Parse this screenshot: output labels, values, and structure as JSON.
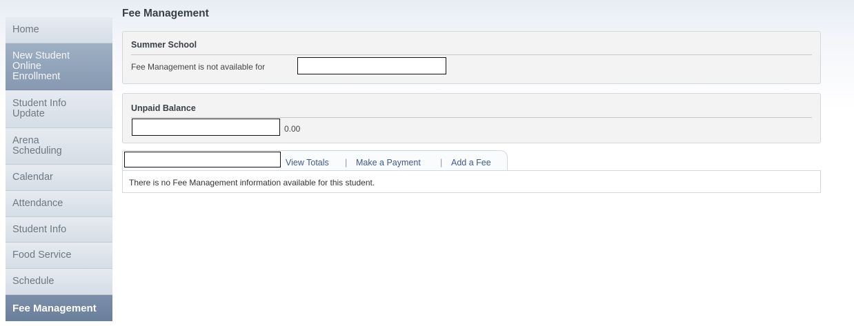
{
  "sidebar": {
    "items": [
      {
        "label": "Home"
      },
      {
        "label": "New Student Online Enrollment"
      },
      {
        "label": "Student Info Update"
      },
      {
        "label": "Arena Scheduling"
      },
      {
        "label": "Calendar"
      },
      {
        "label": "Attendance"
      },
      {
        "label": "Student Info"
      },
      {
        "label": "Food Service"
      },
      {
        "label": "Schedule"
      },
      {
        "label": "Fee Management"
      }
    ]
  },
  "main": {
    "title": "Fee Management",
    "summer_school": {
      "heading": "Summer School",
      "message": "Fee Management is not available for"
    },
    "unpaid_balance": {
      "heading": "Unpaid Balance",
      "amount": "0.00"
    },
    "tabs": {
      "view_totals": "View Totals",
      "make_payment": "Make a Payment",
      "add_fee": "Add a Fee",
      "separator": "|"
    },
    "info_message": "There is no Fee Management information available for this student."
  }
}
